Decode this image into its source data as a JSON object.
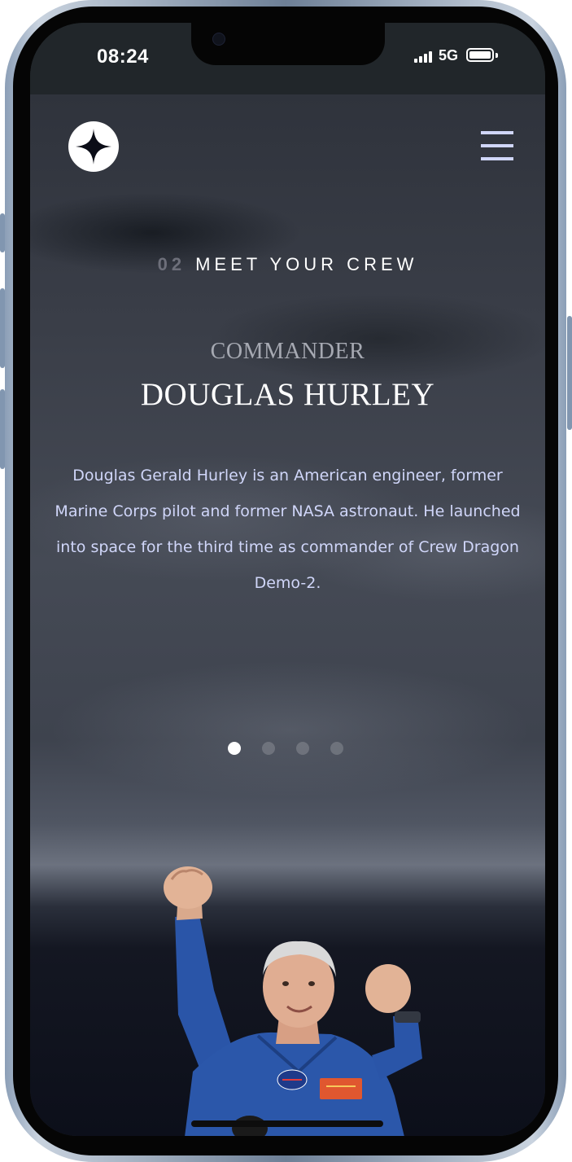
{
  "status_bar": {
    "time": "08:24",
    "network": "5G",
    "battery_level": 1.0,
    "signal-bars": 4
  },
  "nav": {
    "logo_icon": "star-logo-icon",
    "menu_icon": "hamburger-menu-icon"
  },
  "section": {
    "number": "02",
    "title": "MEET YOUR CREW"
  },
  "crew": {
    "role": "COMMANDER",
    "name": "DOUGLAS HURLEY",
    "bio": "Douglas Gerald Hurley is an American engineer, former Marine Corps pilot and former NASA astronaut. He launched into space for the third time as commander of Crew Dragon Demo-2.",
    "image_alt": "Douglas Hurley"
  },
  "pagination": {
    "count": 4,
    "active_index": 0
  },
  "colors": {
    "background_dark": "#0c0f1a",
    "text_light": "#d0d6f9",
    "white": "#ffffff",
    "muted": "#6d6f7a",
    "suit_blue": "#2a55a8"
  }
}
